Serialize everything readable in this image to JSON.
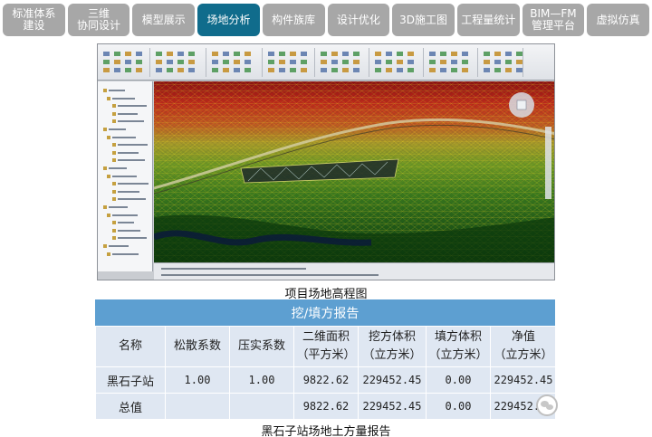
{
  "tabs": [
    {
      "lines": [
        "标准体系",
        "建设"
      ],
      "active": false
    },
    {
      "lines": [
        "三维",
        "协同设计"
      ],
      "active": false
    },
    {
      "lines": [
        "模型展示"
      ],
      "active": false
    },
    {
      "lines": [
        "场地分析"
      ],
      "active": true
    },
    {
      "lines": [
        "构件族库"
      ],
      "active": false
    },
    {
      "lines": [
        "设计优化"
      ],
      "active": false
    },
    {
      "lines": [
        "3D施工图"
      ],
      "active": false
    },
    {
      "lines": [
        "工程量统计"
      ],
      "active": false
    },
    {
      "lines": [
        "BIM—FM",
        "管理平台"
      ],
      "active": false
    },
    {
      "lines": [
        "虚拟仿真"
      ],
      "active": false
    }
  ],
  "colors": {
    "tab_active": "#106c8c",
    "tab_inactive": "#a7a7a7",
    "report_header": "#5d9fd1",
    "cell_bg": "#dfe7f2"
  },
  "figure": {
    "caption": "项目场地高程图",
    "icon": "terrain-elevation-map"
  },
  "report": {
    "title": "挖/填方报告",
    "columns": [
      [
        "名称"
      ],
      [
        "松散系数"
      ],
      [
        "压实系数"
      ],
      [
        "二维面积",
        "（平方米）"
      ],
      [
        "挖方体积",
        "（立方米）"
      ],
      [
        "填方体积",
        "（立方米）"
      ],
      [
        "净值",
        "（立方米）"
      ]
    ],
    "rows": [
      [
        "黑石子站",
        "1.00",
        "1.00",
        "9822.62",
        "229452.45",
        "0.00",
        "229452.45"
      ],
      [
        "总值",
        "",
        "",
        "9822.62",
        "229452.45",
        "0.00",
        "229452.45"
      ]
    ],
    "caption": "黑石子站场地土方量报告"
  },
  "watermark": {
    "icon": "wechat-icon"
  }
}
